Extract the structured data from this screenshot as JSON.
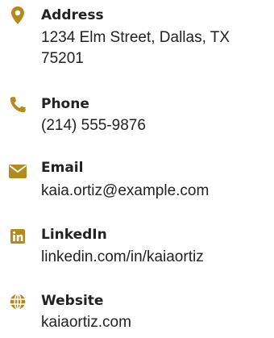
{
  "theme": {
    "accent": "#b38a1e",
    "text": "#222222"
  },
  "contacts": [
    {
      "icon": "map-marker-icon",
      "label": "Address",
      "value": "1234 Elm Street, Dallas, TX 75201"
    },
    {
      "icon": "phone-icon",
      "label": "Phone",
      "value": "(214) 555-9876"
    },
    {
      "icon": "envelope-icon",
      "label": "Email",
      "value": "kaia.ortiz@example.com"
    },
    {
      "icon": "linkedin-icon",
      "label": "LinkedIn",
      "value": "linkedin.com/in/kaiaortiz"
    },
    {
      "icon": "globe-icon",
      "label": "Website",
      "value": "kaiaortiz.com"
    }
  ]
}
